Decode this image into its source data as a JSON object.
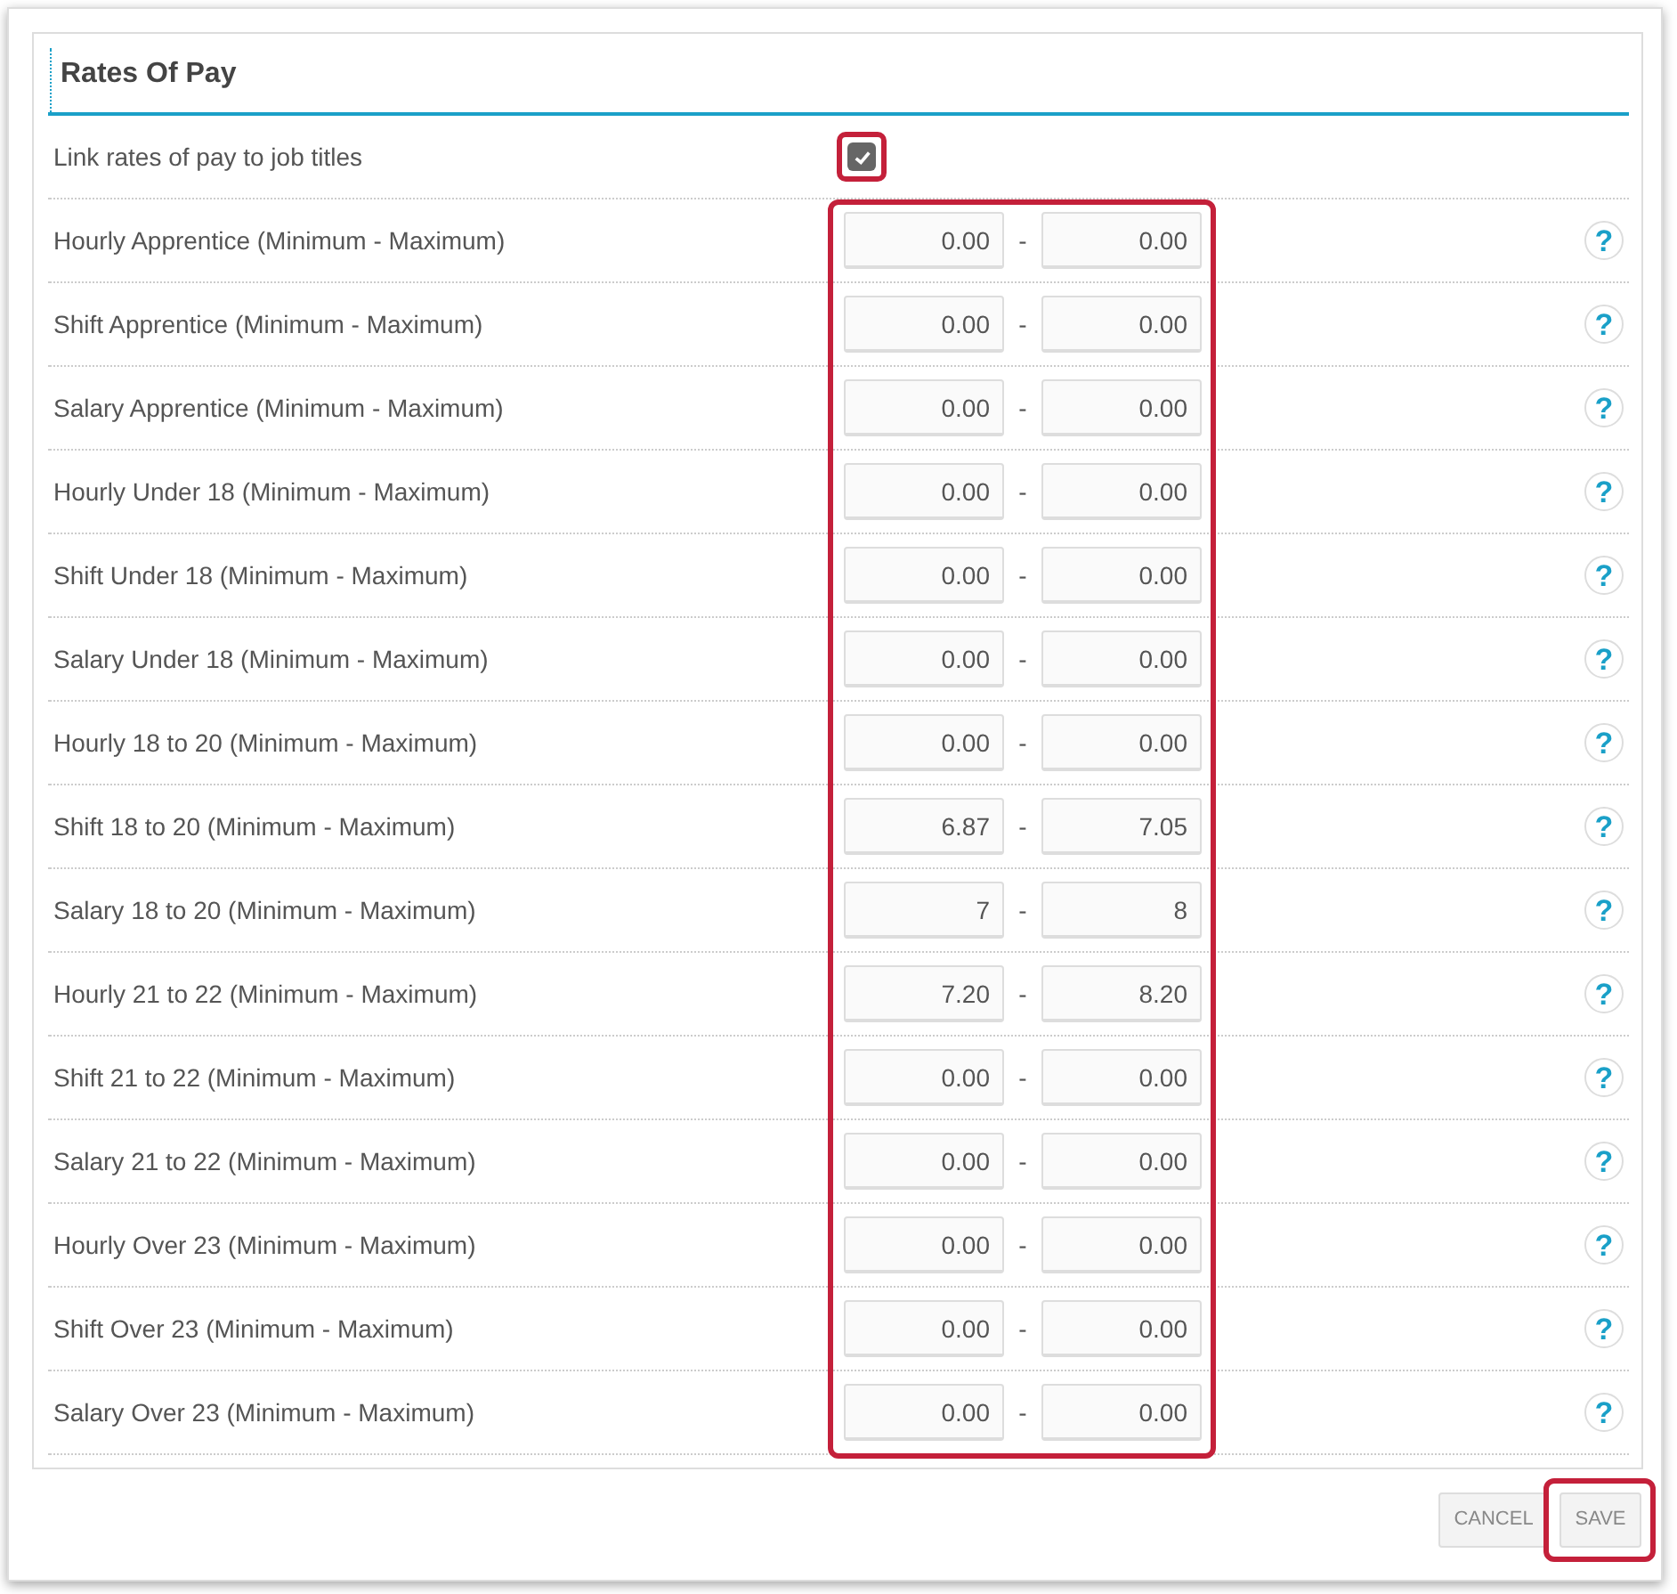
{
  "section": {
    "title": "Rates Of Pay"
  },
  "link_option": {
    "label": "Link rates of pay to job titles",
    "checked": true,
    "highlighted": true
  },
  "rates_highlighted": true,
  "rates": [
    {
      "label": "Hourly Apprentice (Minimum - Maximum)",
      "min": "0.00",
      "separator": "-",
      "max": "0.00",
      "help": "?"
    },
    {
      "label": "Shift Apprentice (Minimum - Maximum)",
      "min": "0.00",
      "separator": "-",
      "max": "0.00",
      "help": "?"
    },
    {
      "label": "Salary Apprentice (Minimum - Maximum)",
      "min": "0.00",
      "separator": "-",
      "max": "0.00",
      "help": "?"
    },
    {
      "label": "Hourly Under 18 (Minimum - Maximum)",
      "min": "0.00",
      "separator": "-",
      "max": "0.00",
      "help": "?"
    },
    {
      "label": "Shift Under 18 (Minimum - Maximum)",
      "min": "0.00",
      "separator": "-",
      "max": "0.00",
      "help": "?"
    },
    {
      "label": "Salary Under 18 (Minimum - Maximum)",
      "min": "0.00",
      "separator": "-",
      "max": "0.00",
      "help": "?"
    },
    {
      "label": "Hourly 18 to 20 (Minimum - Maximum)",
      "min": "0.00",
      "separator": "-",
      "max": "0.00",
      "help": "?"
    },
    {
      "label": "Shift 18 to 20 (Minimum - Maximum)",
      "min": "6.87",
      "separator": "-",
      "max": "7.05",
      "help": "?"
    },
    {
      "label": "Salary 18 to 20 (Minimum - Maximum)",
      "min": "7",
      "separator": "-",
      "max": "8",
      "help": "?"
    },
    {
      "label": "Hourly 21 to 22 (Minimum - Maximum)",
      "min": "7.20",
      "separator": "-",
      "max": "8.20",
      "help": "?"
    },
    {
      "label": "Shift 21 to 22 (Minimum - Maximum)",
      "min": "0.00",
      "separator": "-",
      "max": "0.00",
      "help": "?"
    },
    {
      "label": "Salary 21 to 22 (Minimum - Maximum)",
      "min": "0.00",
      "separator": "-",
      "max": "0.00",
      "help": "?"
    },
    {
      "label": "Hourly Over 23 (Minimum - Maximum)",
      "min": "0.00",
      "separator": "-",
      "max": "0.00",
      "help": "?"
    },
    {
      "label": "Shift Over 23 (Minimum - Maximum)",
      "min": "0.00",
      "separator": "-",
      "max": "0.00",
      "help": "?"
    },
    {
      "label": "Salary Over 23 (Minimum - Maximum)",
      "min": "0.00",
      "separator": "-",
      "max": "0.00",
      "help": "?"
    }
  ],
  "buttons": [
    {
      "label": "CANCEL",
      "kind": "cancel",
      "highlighted": false
    },
    {
      "label": "SAVE",
      "kind": "save",
      "highlighted": true
    }
  ]
}
